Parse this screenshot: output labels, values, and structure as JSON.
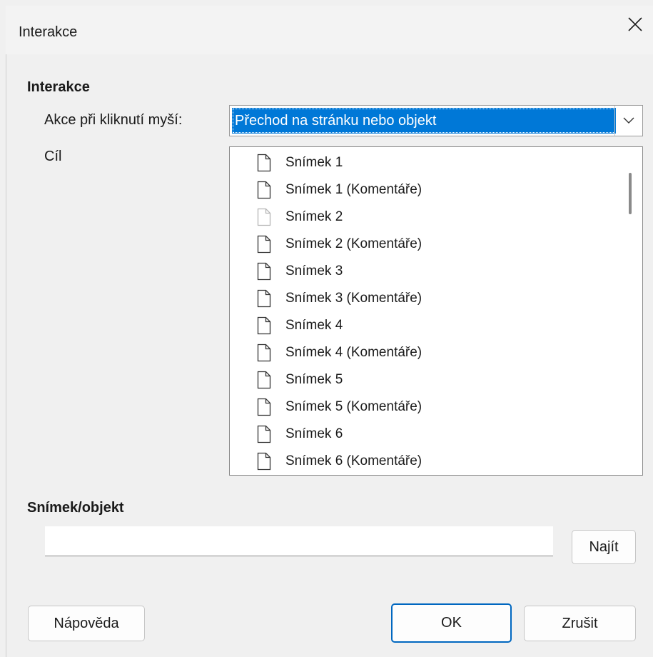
{
  "window": {
    "title": "Interakce"
  },
  "interaction": {
    "section_label": "Interakce",
    "action_label": "Akce při kliknutí myší:",
    "action_value": "Přechod na stránku nebo objekt",
    "target_label": "Cíl",
    "targets": [
      "Snímek 1",
      "Snímek 1 (Komentáře)",
      "Snímek 2",
      "Snímek 2 (Komentáře)",
      "Snímek 3",
      "Snímek 3 (Komentáře)",
      "Snímek 4",
      "Snímek 4 (Komentáře)",
      "Snímek 5",
      "Snímek 5 (Komentáře)",
      "Snímek 6",
      "Snímek 6 (Komentáře)"
    ]
  },
  "slide_object": {
    "section_label": "Snímek/objekt",
    "input_value": "",
    "find_label": "Najít"
  },
  "buttons": {
    "help": "Nápověda",
    "ok": "OK",
    "cancel": "Zrušit"
  },
  "colors": {
    "selection": "#0078d7",
    "default_button_border": "#0067c0"
  },
  "icons": {
    "close": "close-icon",
    "dropdown": "chevron-down-icon",
    "slide": "document-icon"
  }
}
